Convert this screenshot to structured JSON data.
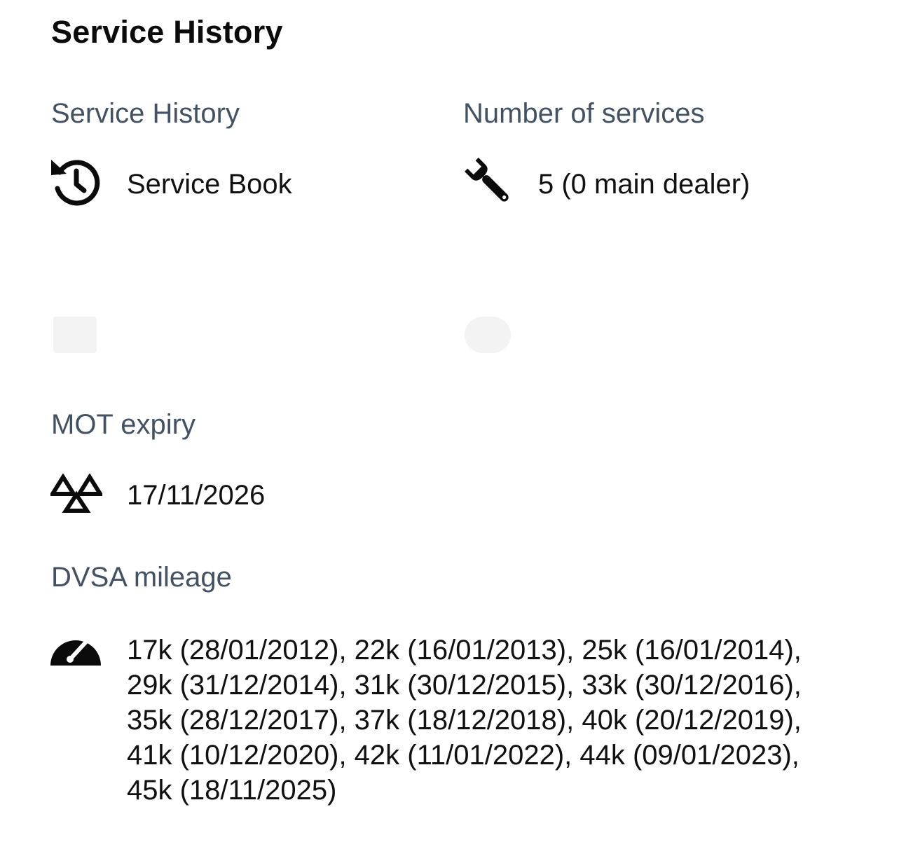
{
  "page": {
    "title": "Service History"
  },
  "service_history": {
    "label": "Service History",
    "value": "Service Book",
    "icon": "history-icon"
  },
  "number_of_services": {
    "label": "Number of services",
    "value": "5 (0 main dealer)",
    "icon": "wrench-icon"
  },
  "mot_expiry": {
    "label": "MOT expiry",
    "value": "17/11/2026",
    "icon": "mot-triangles-icon"
  },
  "dvsa_mileage": {
    "label": "DVSA mileage",
    "value": "17k (28/01/2012), 22k (16/01/2013), 25k (16/01/2014), 29k (31/12/2014), 31k (30/12/2015), 33k (30/12/2016), 35k (28/12/2017), 37k (18/12/2018), 40k (20/12/2019), 41k (10/12/2020), 42k (11/01/2022), 44k (09/01/2023), 45k (18/11/2025)",
    "icon": "speedometer-icon"
  },
  "colors": {
    "label": "#435263",
    "text": "#111111",
    "background": "#ffffff"
  }
}
